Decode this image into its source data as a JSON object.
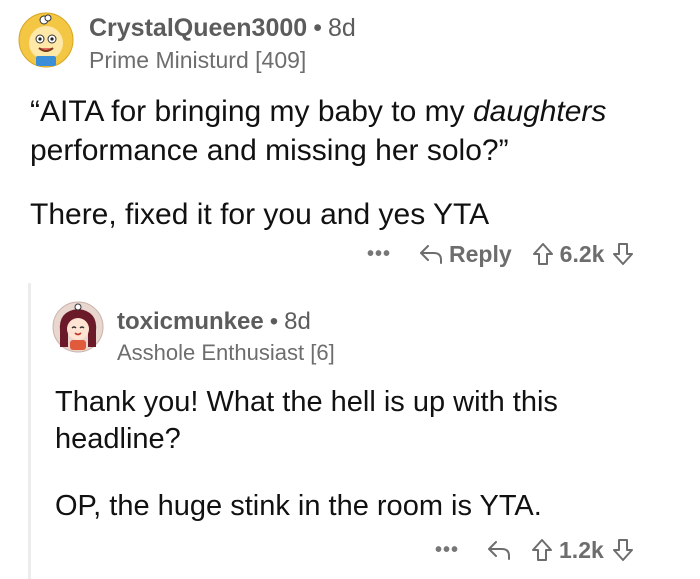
{
  "comments": [
    {
      "username": "CrystalQueen3000",
      "age": "8d",
      "flair": "Prime Ministurd [409]",
      "paragraphs": {
        "p1_prefix": "“AITA for bringing my baby to my ",
        "p1_italic": "daughters",
        "p1_suffix": " performance and missing her solo?”",
        "p2": "There, fixed it for you and yes YTA"
      },
      "more_label": "•••",
      "reply_label": "Reply",
      "score": "6.2k"
    },
    {
      "username": "toxicmunkee",
      "age": "8d",
      "flair": "Asshole Enthusiast [6]",
      "paragraphs": {
        "p1": "Thank you! What the hell is up with this headline?",
        "p2": "OP, the huge stink in the room is YTA."
      },
      "more_label": "•••",
      "score": "1.2k"
    }
  ],
  "icons": {
    "avatar1": "lion-avatar-icon",
    "avatar2": "girl-avatar-icon",
    "reply": "reply-arrow-icon",
    "upvote": "upvote-arrow-icon",
    "downvote": "downvote-arrow-icon"
  },
  "colors": {
    "avatar1_bg": "#f3c644",
    "avatar2_bg": "#e8d6cf",
    "meta_text": "#5c5c5c",
    "body_text": "#111111"
  }
}
